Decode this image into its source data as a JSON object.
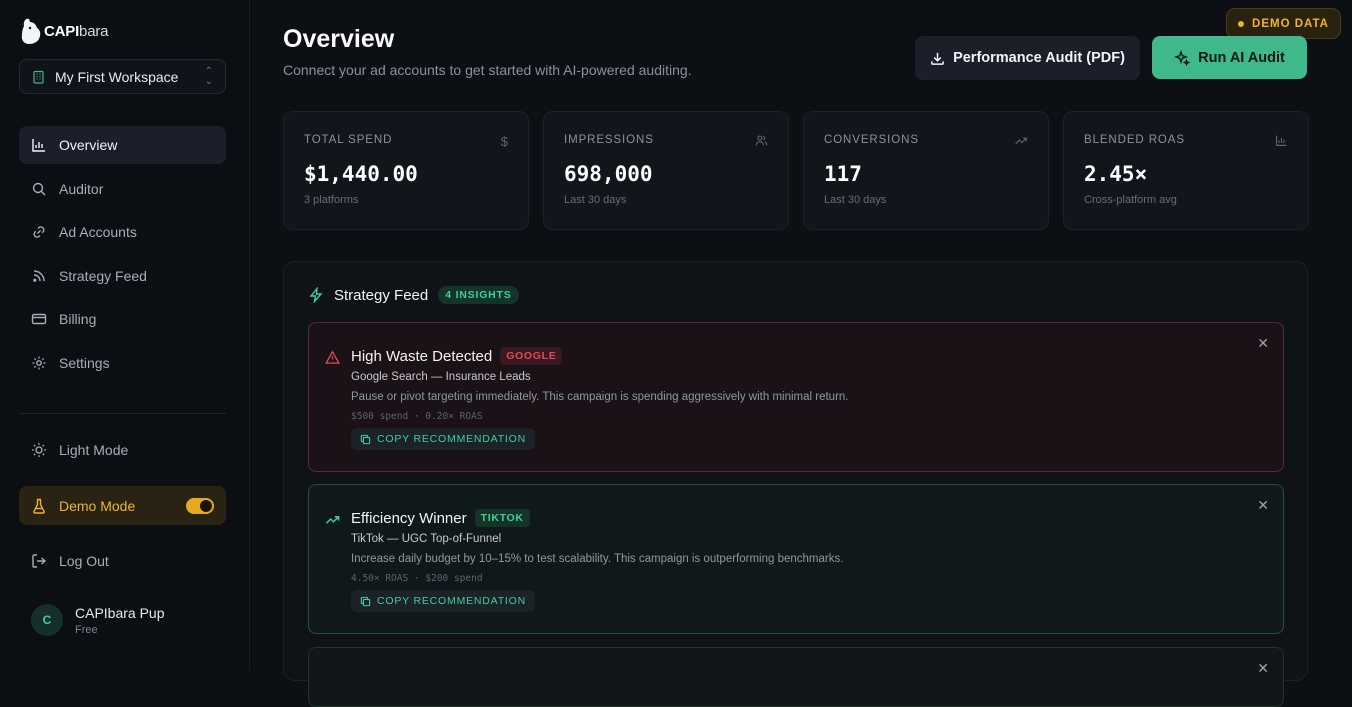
{
  "brand": {
    "bold": "CAPI",
    "light": "bara"
  },
  "workspace": {
    "name": "My First Workspace"
  },
  "nav": [
    {
      "label": "Overview",
      "icon": "bar-chart-icon",
      "active": true
    },
    {
      "label": "Auditor",
      "icon": "search-icon"
    },
    {
      "label": "Ad Accounts",
      "icon": "link-icon"
    },
    {
      "label": "Strategy Feed",
      "icon": "rss-icon"
    },
    {
      "label": "Billing",
      "icon": "credit-card-icon"
    },
    {
      "label": "Settings",
      "icon": "gear-icon"
    }
  ],
  "light_mode": {
    "label": "Light Mode"
  },
  "demo_mode": {
    "label": "Demo Mode",
    "enabled": true
  },
  "logout": {
    "label": "Log Out"
  },
  "user": {
    "initial": "C",
    "name": "CAPIbara Pup",
    "plan": "Free"
  },
  "header": {
    "title": "Overview",
    "subtitle": "Connect your ad accounts to get started with AI-powered auditing.",
    "demo_badge": "DEMO DATA",
    "pdf_button": "Performance Audit (PDF)",
    "ai_button": "Run AI Audit"
  },
  "stats": [
    {
      "label": "TOTAL SPEND",
      "value": "$1,440.00",
      "sub": "3 platforms",
      "icon": "dollar-icon"
    },
    {
      "label": "IMPRESSIONS",
      "value": "698,000",
      "sub": "Last 30 days",
      "icon": "users-icon"
    },
    {
      "label": "CONVERSIONS",
      "value": "117",
      "sub": "Last 30 days",
      "icon": "trend-up-icon"
    },
    {
      "label": "BLENDED ROAS",
      "value": "2.45×",
      "sub": "Cross-platform avg",
      "icon": "bar-chart-icon"
    }
  ],
  "feed": {
    "title": "Strategy Feed",
    "count_badge": "4 INSIGHTS",
    "cards": [
      {
        "title": "High Waste Detected",
        "platform": "GOOGLE",
        "campaign": "Google Search — Insurance Leads",
        "description": "Pause or pivot targeting immediately. This campaign is spending aggressively with minimal return.",
        "meta": "$500 spend · 0.20× ROAS",
        "copy_label": "COPY RECOMMENDATION",
        "severity_color": "#e04a5a"
      },
      {
        "title": "Efficiency Winner",
        "platform": "TIKTOK",
        "campaign": "TikTok — UGC Top-of-Funnel",
        "description": "Increase daily budget by 10–15% to test scalability. This campaign is outperforming benchmarks.",
        "meta": "4.50× ROAS · $200 spend",
        "copy_label": "COPY RECOMMENDATION",
        "severity_color": "#3fcf9e"
      }
    ]
  },
  "colors": {
    "accent": "#3fb98a",
    "warning": "#f0b429",
    "danger": "#e04a5a",
    "background": "#0c0f14"
  }
}
